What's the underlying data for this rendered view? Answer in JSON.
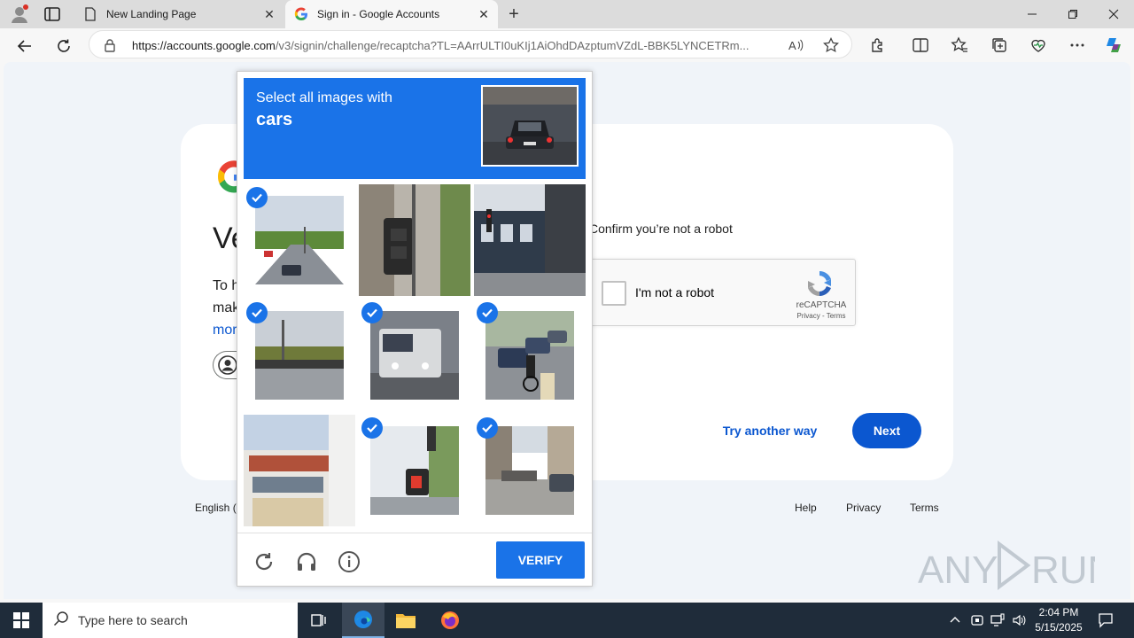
{
  "browser": {
    "tabs": [
      {
        "title": "New Landing Page",
        "icon": "page-icon"
      },
      {
        "title": "Sign in - Google Accounts",
        "icon": "google-icon"
      }
    ],
    "url_host": "https://accounts.google.com",
    "url_path": "/v3/signin/challenge/recaptcha?TL=AArrULTI0uKIj1AiOhdDAzptumVZdL-BBK5LYNCETRm..."
  },
  "signin": {
    "heading": "Ve",
    "desc_line1": "To h",
    "desc_line2": "mak",
    "desc_line3": "mor",
    "confirm_text": "Confirm you’re not a robot",
    "recaptcha_label": "I'm not a robot",
    "recaptcha_brand": "reCAPTCHA",
    "recaptcha_links": "Privacy - Terms",
    "try_another": "Try another way",
    "next": "Next"
  },
  "footer": {
    "language": "English (",
    "help": "Help",
    "privacy": "Privacy",
    "terms": "Terms"
  },
  "challenge": {
    "instruction": "Select all images with",
    "target": "cars",
    "verify": "VERIFY",
    "tiles": [
      {
        "selected": true
      },
      {
        "selected": false
      },
      {
        "selected": false
      },
      {
        "selected": true
      },
      {
        "selected": true
      },
      {
        "selected": true
      },
      {
        "selected": false
      },
      {
        "selected": true
      },
      {
        "selected": true
      }
    ]
  },
  "taskbar": {
    "search_placeholder": "Type here to search",
    "time": "2:04 PM",
    "date": "5/15/2025"
  },
  "colors": {
    "accent": "#1a73e8",
    "google_blue": "#0b57d0",
    "taskbar": "#1f2c3a"
  }
}
